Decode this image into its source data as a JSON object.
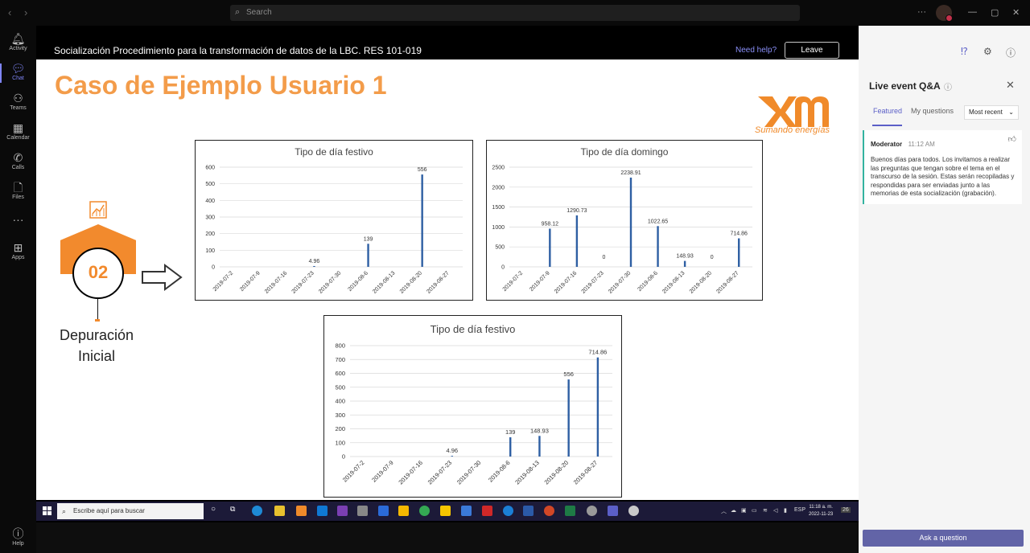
{
  "titlebar": {
    "search_placeholder": "Search",
    "more_label": "···",
    "nav_back": "‹",
    "nav_forward": "›"
  },
  "rail": {
    "items": [
      {
        "label": "Activity",
        "icon": "bell-icon"
      },
      {
        "label": "Chat",
        "icon": "chat-icon"
      },
      {
        "label": "Teams",
        "icon": "teams-icon"
      },
      {
        "label": "Calendar",
        "icon": "calendar-icon"
      },
      {
        "label": "Calls",
        "icon": "phone-icon"
      },
      {
        "label": "Files",
        "icon": "file-icon"
      },
      {
        "label": "···",
        "icon": "more-icon"
      },
      {
        "label": "Apps",
        "icon": "apps-icon"
      }
    ],
    "help_label": "Help",
    "active_color": "#7f85f5"
  },
  "event": {
    "title": "Socialización Procedimiento para la transformación de datos de la LBC. RES 101-019",
    "need_help": "Need help?",
    "leave": "Leave"
  },
  "slide": {
    "title": "Caso de Ejemplo Usuario 1",
    "logo_tagline": "Sumando energías",
    "step_number": "02",
    "step_line1": "Depuración",
    "step_line2": "Inicial",
    "accent_color": "#f28a2d"
  },
  "chart_data": [
    {
      "type": "bar",
      "title": "Tipo de día festivo",
      "categories": [
        "2019-07-2",
        "2019-07-9",
        "2019-07-16",
        "2019-07-23",
        "2019-07-30",
        "2019-08-6",
        "2019-08-13",
        "2019-08-20",
        "2019-08-27"
      ],
      "values": [
        null,
        null,
        null,
        4.96,
        null,
        139,
        null,
        556,
        null
      ],
      "data_labels": [
        null,
        null,
        null,
        "4.96",
        null,
        "139",
        null,
        "556",
        null
      ],
      "ylim": [
        0,
        600
      ],
      "yticks": [
        0,
        100,
        200,
        300,
        400,
        500,
        600
      ],
      "grid": true,
      "color": "#2e5fa3"
    },
    {
      "type": "bar",
      "title": "Tipo de día domingo",
      "categories": [
        "2019-07-2",
        "2019-07-9",
        "2019-07-16",
        "2019-07-23",
        "2019-07-30",
        "2019-08-6",
        "2019-08-13",
        "2019-08-20",
        "2019-08-27"
      ],
      "values": [
        null,
        958.12,
        1290.73,
        0,
        2238.91,
        1022.65,
        148.93,
        0,
        714.86
      ],
      "data_labels": [
        null,
        "958.12",
        "1290.73",
        "0",
        "2238.91",
        "1022.65",
        "148.93",
        "0",
        "714.86"
      ],
      "ylim": [
        0,
        2500
      ],
      "yticks": [
        0,
        500,
        1000,
        1500,
        2000,
        2500
      ],
      "grid": true,
      "color": "#2e5fa3"
    },
    {
      "type": "bar",
      "title": "Tipo de día festivo",
      "categories": [
        "2019-07-2",
        "2019-07-9",
        "2019-07-16",
        "2019-07-23",
        "2019-07-30",
        "2019-08-6",
        "2019-08-13",
        "2019-08-20",
        "2019-08-27"
      ],
      "values": [
        null,
        null,
        null,
        4.96,
        null,
        139,
        148.93,
        556,
        714.86
      ],
      "data_labels": [
        null,
        null,
        null,
        "4.96",
        null,
        "139",
        "148.93",
        "556",
        "714.86"
      ],
      "ylim": [
        0,
        800
      ],
      "yticks": [
        0,
        100,
        200,
        300,
        400,
        500,
        600,
        700,
        800
      ],
      "grid": true,
      "color": "#2e5fa3"
    }
  ],
  "taskbar": {
    "search_placeholder": "Escribe aquí para buscar",
    "language": "ESP",
    "time": "11:18 a. m.",
    "date": "2022-11-23",
    "notifications": "26"
  },
  "panel": {
    "title": "Live event Q&A",
    "tabs": [
      "Featured",
      "My questions"
    ],
    "sort": "Most recent",
    "message": {
      "author": "Moderator",
      "time": "11:12 AM",
      "body": "Buenos días para todos. Los invitamos a realizar las preguntas que tengan sobre el tema en el transcurso de la sesión. Estas serán recopiladas y respondidas para ser enviadas junto a las memorias de esta socialización (grabación)."
    },
    "ask_button": "Ask a question",
    "accent_color": "#5b5fc7"
  }
}
